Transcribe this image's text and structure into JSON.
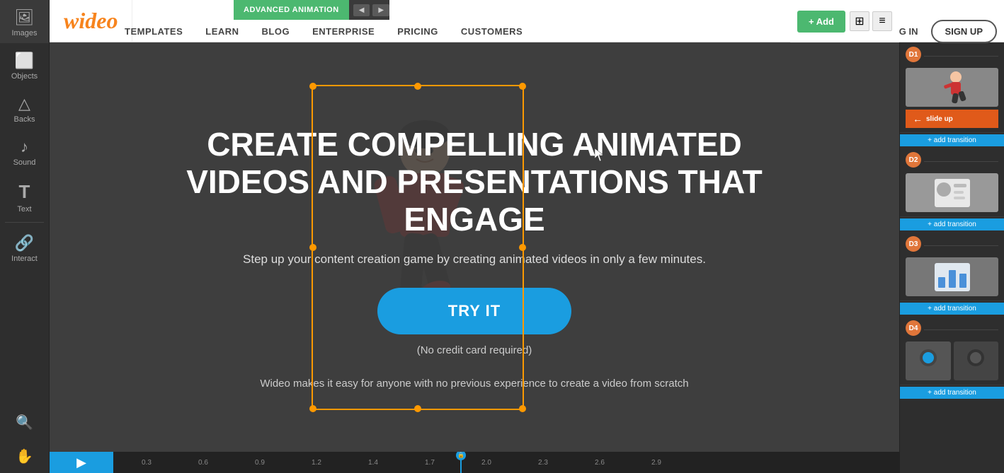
{
  "logo": "wideo",
  "navbar": {
    "anim_button": "ADVANCED ANIMATION",
    "links": [
      "TEMPLATES",
      "LEARN",
      "BLOG",
      "ENTERPRISE",
      "PRICING",
      "CUSTOMERS"
    ],
    "login": "LOG IN",
    "signup": "SIGN UP"
  },
  "sidebar": {
    "items": [
      {
        "label": "Images",
        "icon": "🖼"
      },
      {
        "label": "Objects",
        "icon": "◻"
      },
      {
        "label": "Backs",
        "icon": "△"
      },
      {
        "label": "Sound",
        "icon": "♪"
      },
      {
        "label": "Text",
        "icon": "T"
      },
      {
        "label": "Interact",
        "icon": "🔗"
      }
    ]
  },
  "hero": {
    "title": "CREATE COMPELLING ANIMATED VIDEOS AND PRESENTATIONS THAT ENGAGE",
    "subtitle": "Step up your content creation game by creating animated videos in only a few minutes.",
    "cta_button": "TRY IT",
    "no_card": "(No credit card required)",
    "bottom_text": "Wideo makes it easy for anyone with no previous experience to create a video from scratch"
  },
  "right_panel": {
    "add_button": "+ Add",
    "slide_up": "slide up",
    "transitions": [
      "+ add transition",
      "+ add transition",
      "+ add transition",
      "+ add transition"
    ]
  },
  "timeline": {
    "markers": [
      "0.3",
      "0.6",
      "0.9",
      "1.2",
      "1.4",
      "1.7",
      "2.0",
      "2.3",
      "2.6",
      "2.9"
    ]
  }
}
